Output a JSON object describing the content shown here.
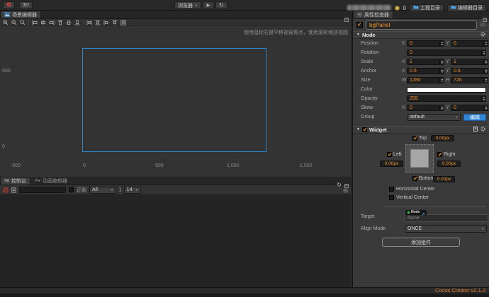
{
  "colors": {
    "accent_orange": "#f0932c",
    "primary_blue": "#2e86d4",
    "canvas_border": "#2d84c8",
    "version_orange": "#e07c26"
  },
  "toolbar": {
    "mode_3d_label": "3D",
    "preview_target_label": "浏览器",
    "counter_value": "0",
    "project_dir_label": "工程目录",
    "editor_dir_label": "编辑器目录"
  },
  "scene_panel": {
    "tab_label": "场景编辑器",
    "hint_text": "使用鼠标右键平移视窗焦点，使用滚轮缩放视图",
    "ruler": {
      "y_labels": [
        "500",
        "0"
      ],
      "x_labels": [
        "-500",
        "0",
        "500",
        "1,000",
        "1,500"
      ]
    }
  },
  "console_panel": {
    "tab_console_label": "控制台",
    "tab_animation_label": "动画编辑器",
    "search_value": "",
    "regex_label": "正则",
    "filter_value": "All",
    "font_size_value": "14"
  },
  "inspector": {
    "tab_label": "属性检查器",
    "node_name": "bgPanel",
    "badge_3d": "3D",
    "node_header": "Node",
    "position": {
      "label": "Position",
      "x_label": "X",
      "x": "0",
      "y_label": "Y",
      "y": "0"
    },
    "rotation": {
      "label": "Rotation",
      "value": "0"
    },
    "scale": {
      "label": "Scale",
      "x_label": "X",
      "x": "1",
      "y_label": "Y",
      "y": "1"
    },
    "anchor": {
      "label": "Anchor",
      "x_label": "X",
      "x": "0.5",
      "y_label": "Y",
      "y": "0.5"
    },
    "size": {
      "label": "Size",
      "w_label": "W",
      "w": "1280",
      "h_label": "H",
      "h": "720"
    },
    "color": {
      "label": "Color",
      "value": "#FFFFFF"
    },
    "opacity": {
      "label": "Opacity",
      "value": "255"
    },
    "skew": {
      "label": "Skew",
      "x_label": "X",
      "x": "0",
      "y_label": "Y",
      "y": "0"
    },
    "group": {
      "label": "Group",
      "value": "default",
      "edit_button": "编辑"
    },
    "widget": {
      "header": "Widget",
      "top_label": "Top",
      "top_value": "0.00px",
      "left_label": "Left",
      "left_value": "0.00px",
      "right_label": "Right",
      "right_value": "0.00px",
      "bottom_label": "Bottom",
      "bottom_value": "0.00px",
      "h_center_label": "Horizontal Center",
      "v_center_label": "Vertical Center",
      "target_label": "Target",
      "target_type_badge": "Node",
      "target_value": "None",
      "align_mode_label": "Align Mode",
      "align_mode_value": "ONCE"
    },
    "add_component_label": "添加组件"
  },
  "statusbar": {
    "version": "Cocos Creator v2.1.2"
  }
}
